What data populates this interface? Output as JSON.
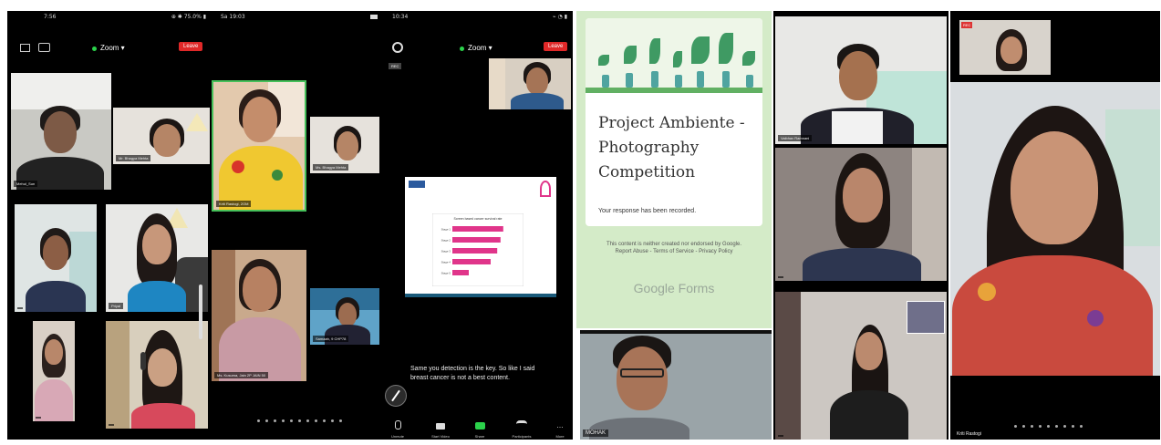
{
  "panel1": {
    "status_time": "7:56",
    "status_right": "⊕ ✱ 75.0% ▮",
    "zoom_label": "Zoom ▾",
    "leave_label": "Leave",
    "tiles": [
      {
        "name": "Mehul_Sun"
      },
      {
        "name": "Mr. Bhagya Mehta"
      },
      {
        "name": ""
      },
      {
        "name": "Priyal"
      },
      {
        "name": ""
      },
      {
        "name": ""
      }
    ]
  },
  "panel2": {
    "status_time": "Sa 19:03",
    "tiles": [
      {
        "name": "Kriti Rastogi, 2OM"
      },
      {
        "name": "Ms. Bhagya Mehta"
      },
      {
        "name": "Ms. Kusuma, Jain 2P JAIN 50"
      },
      {
        "name": "Samaah, 9 CHP78"
      }
    ]
  },
  "panel3": {
    "status_time": "10:34",
    "status_right": "⌁ ◔ ▮",
    "zoom_label": "Zoom ▾",
    "leave_label": "Leave",
    "rec_label": "REC",
    "slide_chart": {
      "type": "bar",
      "title": "Screen based cancer survival rate",
      "categories": [
        "Stage 1",
        "Stage 2",
        "Stage 3",
        "Stage 4",
        "Stage 5"
      ],
      "values": [
        93,
        88,
        82,
        70,
        30
      ],
      "bar_color": "#e0358a"
    },
    "caption": "Same you detection is the key. So like I said breast cancer is not a best content.",
    "toolbar": [
      {
        "label": "Unmute",
        "icon": "mic-icon"
      },
      {
        "label": "Start Video",
        "icon": "video-icon"
      },
      {
        "label": "Share",
        "icon": "share-icon"
      },
      {
        "label": "Participants",
        "icon": "participants-icon"
      },
      {
        "label": "More",
        "icon": "more-icon"
      }
    ]
  },
  "form_panel": {
    "title": "Project Ambiente - Photography Competition",
    "response_text": "Your response has been recorded.",
    "disclaimer": "This content is neither created nor endorsed by Google. Report Abuse - Terms of Service - Privacy Policy",
    "brand": "Google Forms",
    "brand_colors": {
      "header": "#c5e3b6",
      "accent": "#61b063",
      "page_bg": "#d4ebc8"
    }
  },
  "panel5": {
    "tiles": [
      {
        "name": "Vaibhav Ramnani"
      },
      {
        "name": ""
      },
      {
        "name": ""
      },
      {
        "name": "MOHAK"
      }
    ]
  },
  "panel6": {
    "rec_label": "REC",
    "name": "Kriti Rastogi"
  }
}
